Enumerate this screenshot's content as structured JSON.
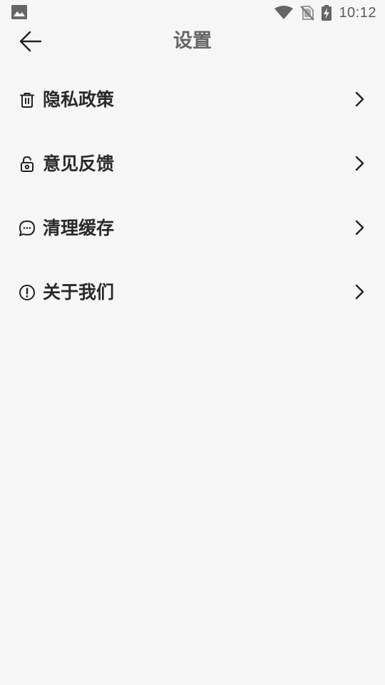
{
  "status_bar": {
    "time": "10:12",
    "icons": [
      "image-icon",
      "wifi-icon",
      "no-sim-icon",
      "battery-charging-icon"
    ]
  },
  "header": {
    "title": "设置",
    "back_icon": "arrow-left-icon"
  },
  "settings": {
    "items": [
      {
        "label": "隐私政策",
        "icon": "trash-icon"
      },
      {
        "label": "意见反馈",
        "icon": "lock-open-icon"
      },
      {
        "label": "清理缓存",
        "icon": "chat-bubble-icon"
      },
      {
        "label": "关于我们",
        "icon": "alert-circle-icon"
      }
    ],
    "chevron_icon": "chevron-right-icon"
  }
}
